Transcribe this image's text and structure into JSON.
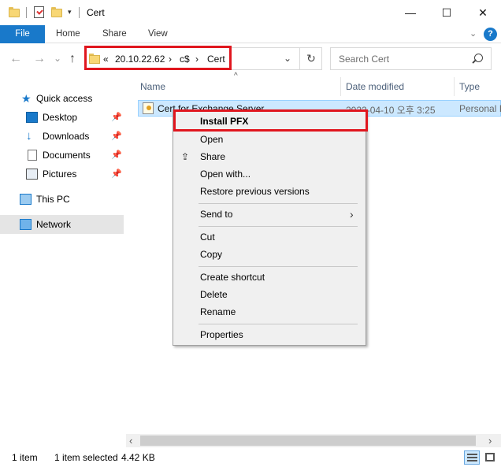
{
  "window": {
    "title": "Cert",
    "controls": {
      "minimize": "—",
      "maximize": "☐",
      "close": "✕"
    }
  },
  "ribbon": {
    "tabs": [
      "File",
      "Home",
      "Share",
      "View"
    ],
    "help_label": "?"
  },
  "nav": {
    "back": "←",
    "forward": "→",
    "recent": "⌄",
    "up": "↑",
    "breadcrumb": [
      "«",
      "20.10.22.62",
      "›",
      "c$",
      "›",
      "Cert"
    ],
    "refresh": "↻",
    "search_placeholder": "Search Cert"
  },
  "sidebar": {
    "items": [
      {
        "label": "Quick access",
        "icon": "star-icon"
      },
      {
        "label": "Desktop",
        "icon": "desktop-icon",
        "pinned": true
      },
      {
        "label": "Downloads",
        "icon": "download-icon",
        "pinned": true
      },
      {
        "label": "Documents",
        "icon": "documents-icon",
        "pinned": true
      },
      {
        "label": "Pictures",
        "icon": "pictures-icon",
        "pinned": true
      },
      {
        "label": "This PC",
        "icon": "computer-icon"
      },
      {
        "label": "Network",
        "icon": "network-icon",
        "selected": true
      }
    ]
  },
  "columns": [
    "Name",
    "Date modified",
    "Type"
  ],
  "files": [
    {
      "name": "Cert for Exchange Server",
      "date": "2022-04-10 오후 3:25",
      "type": "Personal I"
    }
  ],
  "context_menu": {
    "items": [
      "Install PFX",
      "Open",
      "Share",
      "Open with...",
      "Restore previous versions",
      "Send to",
      "Cut",
      "Copy",
      "Create shortcut",
      "Delete",
      "Rename",
      "Properties"
    ]
  },
  "status": {
    "count": "1 item",
    "selected": "1 item selected",
    "size": "4.42 KB"
  },
  "colors": {
    "accent": "#1979ca",
    "selection": "#cce8ff",
    "highlight_border": "#e0161e"
  }
}
